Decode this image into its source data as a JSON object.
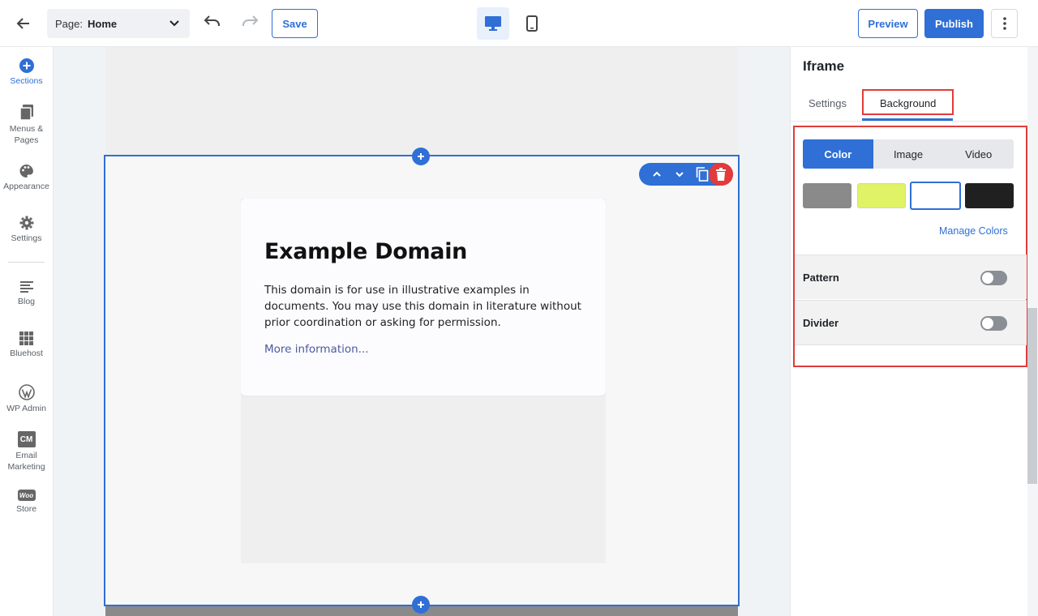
{
  "topbar": {
    "page_label": "Page:",
    "page_value": "Home",
    "save_label": "Save",
    "preview_label": "Preview",
    "publish_label": "Publish"
  },
  "sidebar": {
    "items": [
      {
        "label": "Sections",
        "icon": "plus-circle-icon"
      },
      {
        "label": "Menus & Pages",
        "icon": "pages-icon"
      },
      {
        "label": "Appearance",
        "icon": "palette-icon"
      },
      {
        "label": "Settings",
        "icon": "gear-icon"
      },
      {
        "label": "Blog",
        "icon": "blog-icon"
      },
      {
        "label": "Bluehost",
        "icon": "grid-icon"
      },
      {
        "label": "WP Admin",
        "icon": "wordpress-icon"
      },
      {
        "label": "Email Marketing",
        "icon": "cm-icon"
      },
      {
        "label": "Store",
        "icon": "woo-icon"
      }
    ],
    "cm_text": "CM",
    "woo_text": "Woo"
  },
  "canvas": {
    "heading": "Example Domain",
    "paragraph": "This domain is for use in illustrative examples in documents. You may use this domain in literature without prior coordination or asking for permission.",
    "link": "More information..."
  },
  "panel": {
    "title": "Iframe",
    "tabs": [
      "Settings",
      "Background"
    ],
    "segments": [
      "Color",
      "Image",
      "Video"
    ],
    "swatches": [
      "#8a8a8a",
      "#e0f266",
      "#ffffff",
      "#202020"
    ],
    "manage_colors": "Manage Colors",
    "pattern_label": "Pattern",
    "divider_label": "Divider"
  },
  "colors": {
    "accent": "#2f6fd6",
    "highlight": "#e03c3c",
    "delete": "#e33b3b"
  }
}
